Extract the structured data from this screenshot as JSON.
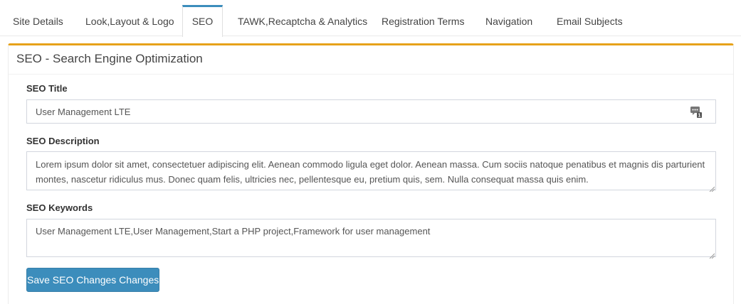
{
  "tabs": [
    {
      "label": "Site Details"
    },
    {
      "label": "Look,Layout & Logo"
    },
    {
      "label": "SEO"
    },
    {
      "label": "TAWK,Recaptcha & Analytics"
    },
    {
      "label": "Registration Terms"
    },
    {
      "label": "Navigation"
    },
    {
      "label": "Email Subjects"
    }
  ],
  "active_tab": "SEO",
  "panel": {
    "title": "SEO - Search Engine Optimization",
    "accent_color": "#e6a21a"
  },
  "form": {
    "seo_title": {
      "label": "SEO Title",
      "value": "User Management LTE"
    },
    "seo_description": {
      "label": "SEO Description",
      "value": "Lorem ipsum dolor sit amet, consectetuer adipiscing elit. Aenean commodo ligula eget dolor. Aenean massa. Cum sociis natoque penatibus et magnis dis parturient montes, nascetur ridiculus mus. Donec quam felis, ultricies nec, pellentesque eu, pretium quis, sem. Nulla consequat massa quis enim."
    },
    "seo_keywords": {
      "label": "SEO Keywords",
      "value": "User Management LTE,User Management,Start a PHP project,Framework for user management"
    },
    "save_label": "Save SEO Changes Changes",
    "save_color": "#3c8dbc"
  },
  "icons": {
    "title_field_icon": "character-count-icon",
    "resize_handle": "resize-handle-icon"
  }
}
